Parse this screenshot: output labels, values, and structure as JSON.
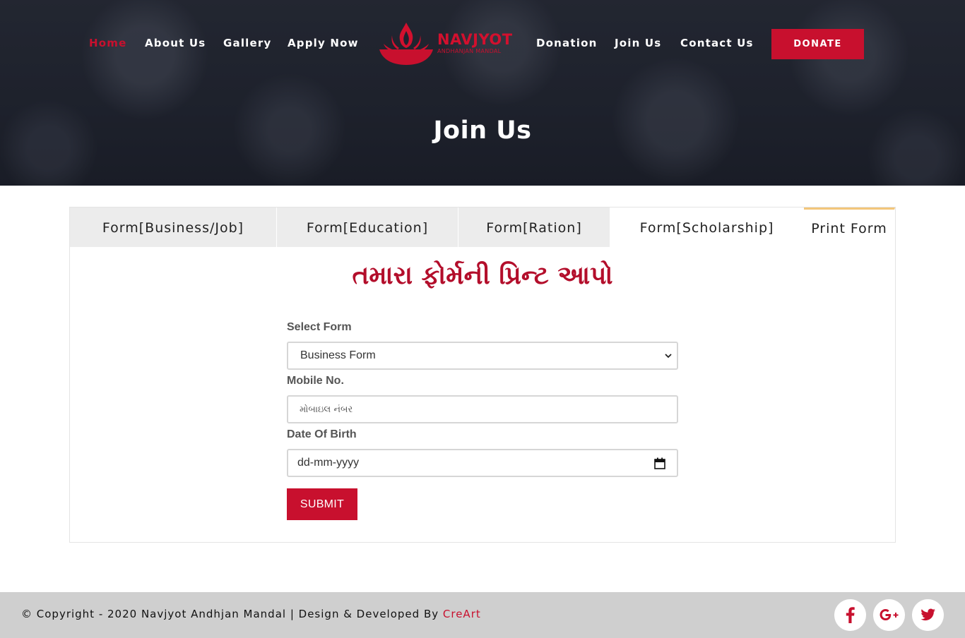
{
  "nav": {
    "items": [
      {
        "label": "Home",
        "active": true
      },
      {
        "label": "About Us"
      },
      {
        "label": "Gallery"
      },
      {
        "label": "Apply Now"
      },
      {
        "label": "Donation"
      },
      {
        "label": "Join Us"
      },
      {
        "label": "Contact Us"
      }
    ],
    "donate_label": "DONATE"
  },
  "logo": {
    "name": "NAVJYOT",
    "subtitle": "ANDHANJAN MANDAL",
    "icon": "lamp-flame-icon"
  },
  "hero": {
    "title": "Join Us"
  },
  "tabs": [
    {
      "label": "Form[Business/Job]"
    },
    {
      "label": "Form[Education]"
    },
    {
      "label": "Form[Ration]"
    },
    {
      "label": "Form[Scholarship]"
    },
    {
      "label": "Print Form",
      "active": true
    }
  ],
  "form": {
    "heading": "તમારા ફોર્મની પ્રિન્ટ આપો",
    "select_label": "Select Form",
    "select_value": "Business Form",
    "mobile_label": "Mobile No.",
    "mobile_placeholder": "મોબાઇલ નંબર",
    "dob_label": "Date Of Birth",
    "dob_value": "dd-mm-yyyy",
    "submit_label": "SUBMIT"
  },
  "footer": {
    "copyright_text": "© Copyright - 2020 Navjyot Andhjan Mandal | Design & Developed By ",
    "developer": "CreArt",
    "social": [
      "facebook-icon",
      "google-plus-icon",
      "twitter-icon"
    ]
  },
  "colors": {
    "brand_red": "#c8102e",
    "tab_active_border": "#f3c67a",
    "tab_bg": "#ececec",
    "footer_bg": "#cfcfcf",
    "hero_dark": "#232733"
  }
}
